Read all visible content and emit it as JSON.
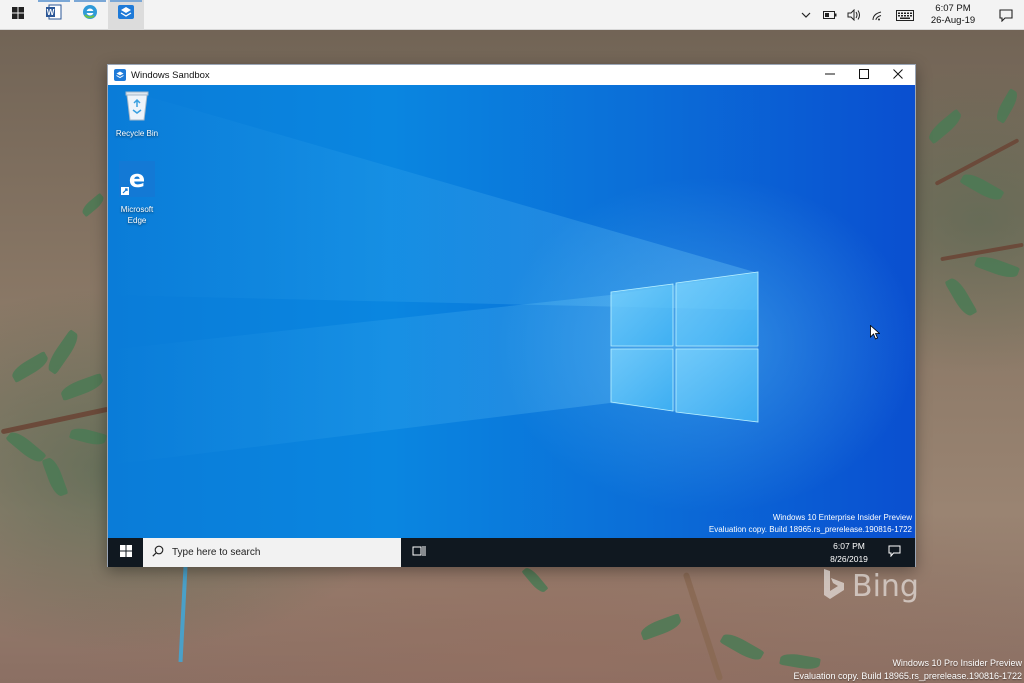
{
  "host_taskbar": {
    "apps": [
      {
        "name": "start-button",
        "icon": "windows-logo-icon"
      },
      {
        "name": "word",
        "icon": "word-icon",
        "label": "W"
      },
      {
        "name": "edge",
        "icon": "edge-icon"
      },
      {
        "name": "sandbox",
        "icon": "sandbox-icon"
      }
    ],
    "clock_time": "6:07 PM",
    "clock_date": "26-Aug-19"
  },
  "sandbox_window": {
    "title": "Windows Sandbox",
    "desktop_icons": [
      {
        "label": "Recycle Bin",
        "icon": "recycle-bin-icon"
      },
      {
        "label": "Microsoft Edge",
        "icon": "edge-icon"
      }
    ],
    "watermark_line1": "Windows 10 Enterprise Insider Preview",
    "watermark_line2": "Evaluation copy. Build 18965.rs_prerelease.190816-1722",
    "taskbar": {
      "search_placeholder": "Type here to search",
      "clock_time": "6:07 PM",
      "clock_date": "8/26/2019"
    }
  },
  "bing_logo_text": "Bing",
  "host_watermark_line1": "Windows 10 Pro Insider Preview",
  "host_watermark_line2": "Evaluation copy. Build 18965.rs_prerelease.190816-1722",
  "colors": {
    "vm_desktop_blue": "#0a7cd8",
    "vm_taskbar": "#101820",
    "host_taskbar": "#f3f3f3"
  }
}
